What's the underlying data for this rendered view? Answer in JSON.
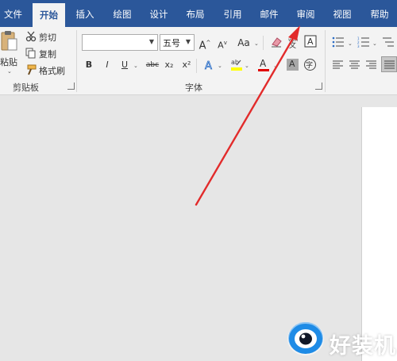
{
  "tabs": [
    {
      "label": "文件"
    },
    {
      "label": "开始"
    },
    {
      "label": "插入"
    },
    {
      "label": "绘图"
    },
    {
      "label": "设计"
    },
    {
      "label": "布局"
    },
    {
      "label": "引用"
    },
    {
      "label": "邮件"
    },
    {
      "label": "审阅"
    },
    {
      "label": "视图"
    },
    {
      "label": "帮助"
    }
  ],
  "active_tab": "开始",
  "clipboard": {
    "paste_label": "粘贴",
    "cut_label": "剪切",
    "copy_label": "复制",
    "format_painter_label": "格式刷",
    "group_label": "剪贴板"
  },
  "font": {
    "font_name_value": "",
    "font_size_value": "五号",
    "grow_label": "A",
    "shrink_label": "A",
    "case_label": "Aa",
    "bold_label": "B",
    "italic_label": "I",
    "underline_label": "U",
    "strikethrough_label": "abc",
    "subscript_label": "x₂",
    "superscript_label": "x²",
    "font_color_label": "A",
    "char_shading_label": "A",
    "enclose_label": "字",
    "group_label": "字体"
  },
  "colors": {
    "brand": "#2b579a",
    "ribbon_bg": "#f3f3f3",
    "canvas_bg": "#e6e6e6",
    "arrow": "#e22b2b",
    "highlight": "#ffff00",
    "font_color": "#e00000",
    "watermark_blue": "#1e8be6"
  },
  "watermark": {
    "text": "好装机"
  }
}
